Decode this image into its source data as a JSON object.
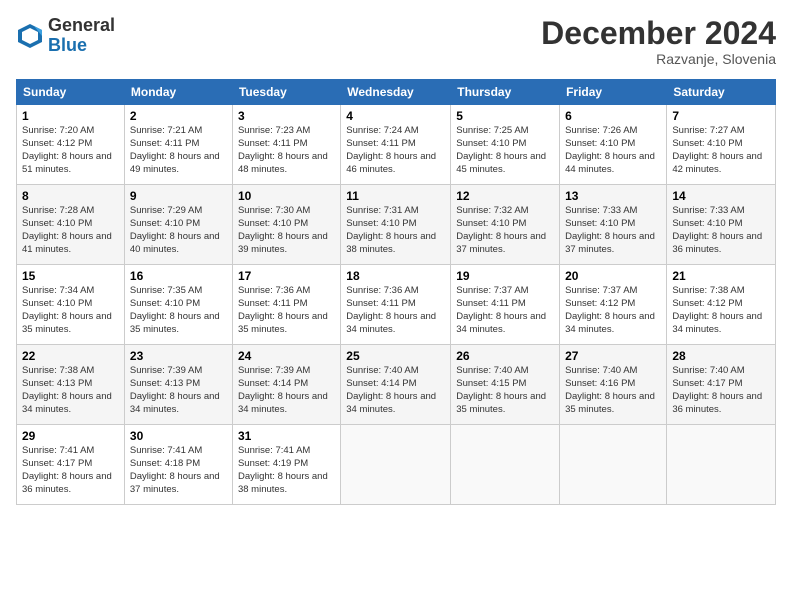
{
  "header": {
    "logo_general": "General",
    "logo_blue": "Blue",
    "month_title": "December 2024",
    "location": "Razvanje, Slovenia"
  },
  "weekdays": [
    "Sunday",
    "Monday",
    "Tuesday",
    "Wednesday",
    "Thursday",
    "Friday",
    "Saturday"
  ],
  "weeks": [
    [
      {
        "day": "1",
        "sunrise": "Sunrise: 7:20 AM",
        "sunset": "Sunset: 4:12 PM",
        "daylight": "Daylight: 8 hours and 51 minutes."
      },
      {
        "day": "2",
        "sunrise": "Sunrise: 7:21 AM",
        "sunset": "Sunset: 4:11 PM",
        "daylight": "Daylight: 8 hours and 49 minutes."
      },
      {
        "day": "3",
        "sunrise": "Sunrise: 7:23 AM",
        "sunset": "Sunset: 4:11 PM",
        "daylight": "Daylight: 8 hours and 48 minutes."
      },
      {
        "day": "4",
        "sunrise": "Sunrise: 7:24 AM",
        "sunset": "Sunset: 4:11 PM",
        "daylight": "Daylight: 8 hours and 46 minutes."
      },
      {
        "day": "5",
        "sunrise": "Sunrise: 7:25 AM",
        "sunset": "Sunset: 4:10 PM",
        "daylight": "Daylight: 8 hours and 45 minutes."
      },
      {
        "day": "6",
        "sunrise": "Sunrise: 7:26 AM",
        "sunset": "Sunset: 4:10 PM",
        "daylight": "Daylight: 8 hours and 44 minutes."
      },
      {
        "day": "7",
        "sunrise": "Sunrise: 7:27 AM",
        "sunset": "Sunset: 4:10 PM",
        "daylight": "Daylight: 8 hours and 42 minutes."
      }
    ],
    [
      {
        "day": "8",
        "sunrise": "Sunrise: 7:28 AM",
        "sunset": "Sunset: 4:10 PM",
        "daylight": "Daylight: 8 hours and 41 minutes."
      },
      {
        "day": "9",
        "sunrise": "Sunrise: 7:29 AM",
        "sunset": "Sunset: 4:10 PM",
        "daylight": "Daylight: 8 hours and 40 minutes."
      },
      {
        "day": "10",
        "sunrise": "Sunrise: 7:30 AM",
        "sunset": "Sunset: 4:10 PM",
        "daylight": "Daylight: 8 hours and 39 minutes."
      },
      {
        "day": "11",
        "sunrise": "Sunrise: 7:31 AM",
        "sunset": "Sunset: 4:10 PM",
        "daylight": "Daylight: 8 hours and 38 minutes."
      },
      {
        "day": "12",
        "sunrise": "Sunrise: 7:32 AM",
        "sunset": "Sunset: 4:10 PM",
        "daylight": "Daylight: 8 hours and 37 minutes."
      },
      {
        "day": "13",
        "sunrise": "Sunrise: 7:33 AM",
        "sunset": "Sunset: 4:10 PM",
        "daylight": "Daylight: 8 hours and 37 minutes."
      },
      {
        "day": "14",
        "sunrise": "Sunrise: 7:33 AM",
        "sunset": "Sunset: 4:10 PM",
        "daylight": "Daylight: 8 hours and 36 minutes."
      }
    ],
    [
      {
        "day": "15",
        "sunrise": "Sunrise: 7:34 AM",
        "sunset": "Sunset: 4:10 PM",
        "daylight": "Daylight: 8 hours and 35 minutes."
      },
      {
        "day": "16",
        "sunrise": "Sunrise: 7:35 AM",
        "sunset": "Sunset: 4:10 PM",
        "daylight": "Daylight: 8 hours and 35 minutes."
      },
      {
        "day": "17",
        "sunrise": "Sunrise: 7:36 AM",
        "sunset": "Sunset: 4:11 PM",
        "daylight": "Daylight: 8 hours and 35 minutes."
      },
      {
        "day": "18",
        "sunrise": "Sunrise: 7:36 AM",
        "sunset": "Sunset: 4:11 PM",
        "daylight": "Daylight: 8 hours and 34 minutes."
      },
      {
        "day": "19",
        "sunrise": "Sunrise: 7:37 AM",
        "sunset": "Sunset: 4:11 PM",
        "daylight": "Daylight: 8 hours and 34 minutes."
      },
      {
        "day": "20",
        "sunrise": "Sunrise: 7:37 AM",
        "sunset": "Sunset: 4:12 PM",
        "daylight": "Daylight: 8 hours and 34 minutes."
      },
      {
        "day": "21",
        "sunrise": "Sunrise: 7:38 AM",
        "sunset": "Sunset: 4:12 PM",
        "daylight": "Daylight: 8 hours and 34 minutes."
      }
    ],
    [
      {
        "day": "22",
        "sunrise": "Sunrise: 7:38 AM",
        "sunset": "Sunset: 4:13 PM",
        "daylight": "Daylight: 8 hours and 34 minutes."
      },
      {
        "day": "23",
        "sunrise": "Sunrise: 7:39 AM",
        "sunset": "Sunset: 4:13 PM",
        "daylight": "Daylight: 8 hours and 34 minutes."
      },
      {
        "day": "24",
        "sunrise": "Sunrise: 7:39 AM",
        "sunset": "Sunset: 4:14 PM",
        "daylight": "Daylight: 8 hours and 34 minutes."
      },
      {
        "day": "25",
        "sunrise": "Sunrise: 7:40 AM",
        "sunset": "Sunset: 4:14 PM",
        "daylight": "Daylight: 8 hours and 34 minutes."
      },
      {
        "day": "26",
        "sunrise": "Sunrise: 7:40 AM",
        "sunset": "Sunset: 4:15 PM",
        "daylight": "Daylight: 8 hours and 35 minutes."
      },
      {
        "day": "27",
        "sunrise": "Sunrise: 7:40 AM",
        "sunset": "Sunset: 4:16 PM",
        "daylight": "Daylight: 8 hours and 35 minutes."
      },
      {
        "day": "28",
        "sunrise": "Sunrise: 7:40 AM",
        "sunset": "Sunset: 4:17 PM",
        "daylight": "Daylight: 8 hours and 36 minutes."
      }
    ],
    [
      {
        "day": "29",
        "sunrise": "Sunrise: 7:41 AM",
        "sunset": "Sunset: 4:17 PM",
        "daylight": "Daylight: 8 hours and 36 minutes."
      },
      {
        "day": "30",
        "sunrise": "Sunrise: 7:41 AM",
        "sunset": "Sunset: 4:18 PM",
        "daylight": "Daylight: 8 hours and 37 minutes."
      },
      {
        "day": "31",
        "sunrise": "Sunrise: 7:41 AM",
        "sunset": "Sunset: 4:19 PM",
        "daylight": "Daylight: 8 hours and 38 minutes."
      },
      null,
      null,
      null,
      null
    ]
  ]
}
